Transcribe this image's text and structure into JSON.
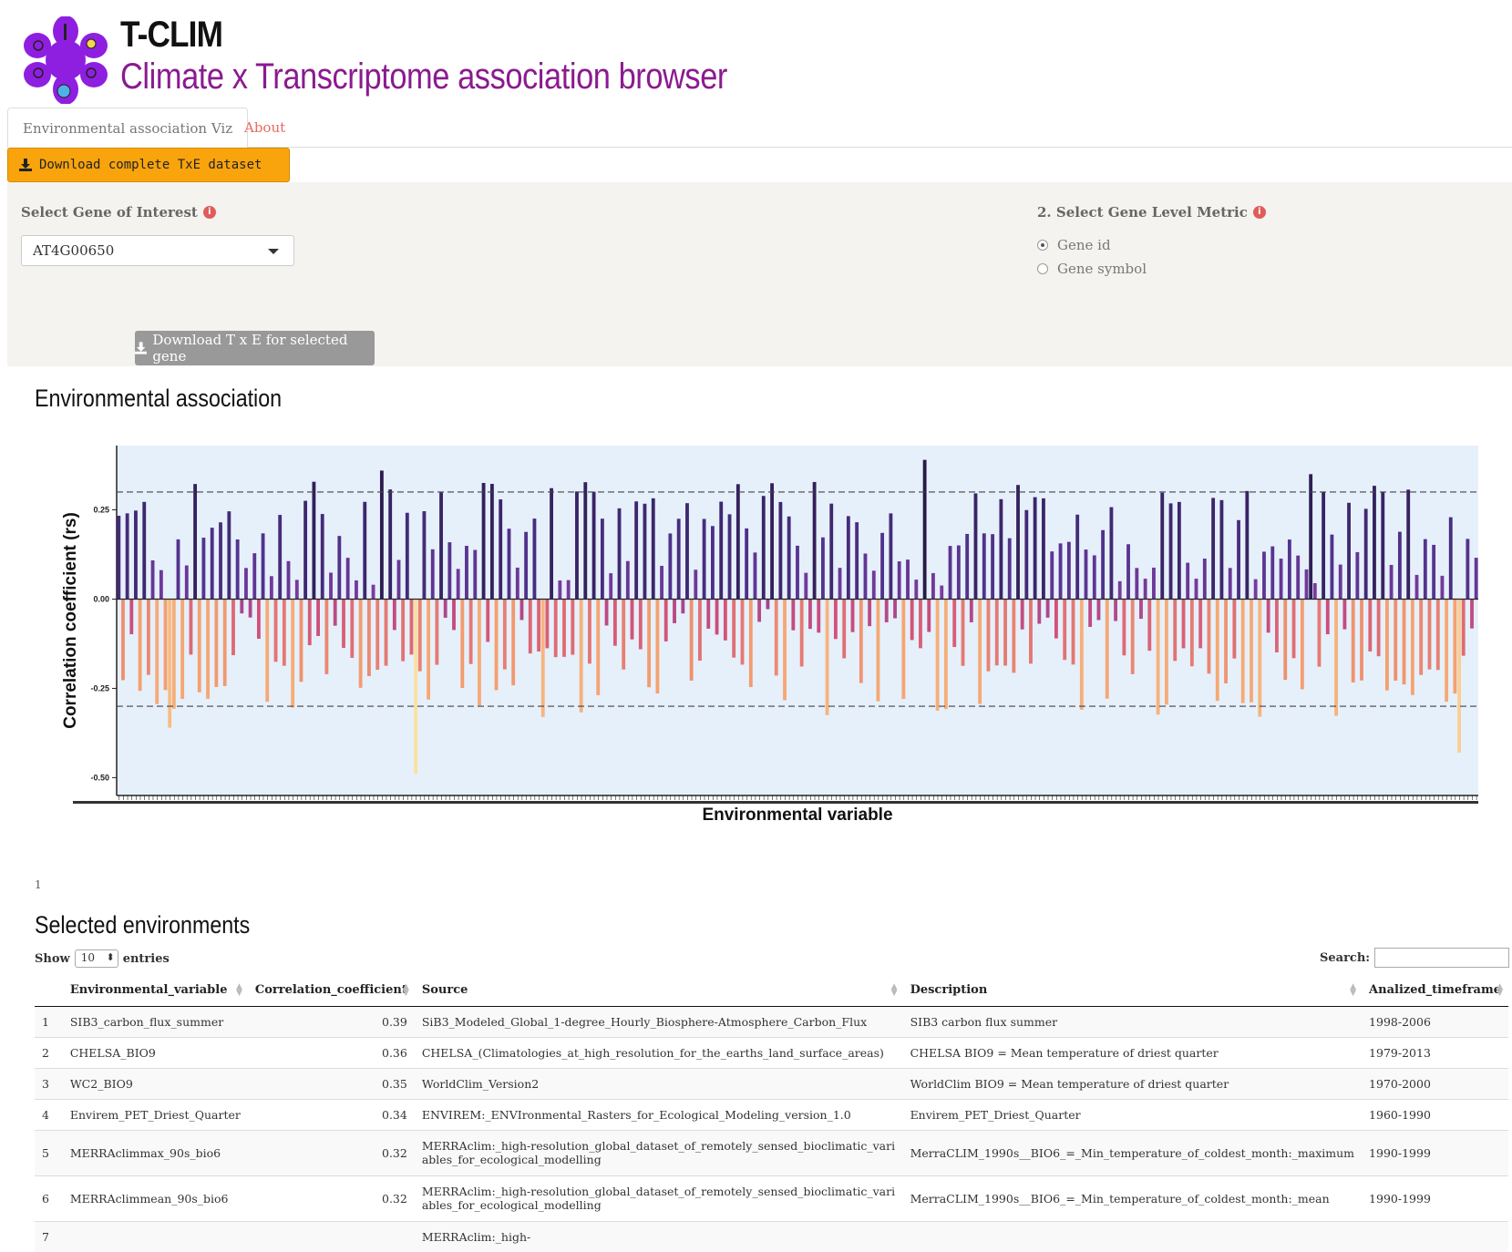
{
  "header": {
    "title": "T-CLIM",
    "subtitle": "Climate x Transcriptome association browser"
  },
  "tabs": [
    {
      "label": "Environmental association Viz",
      "active": true
    },
    {
      "label": "About",
      "active": false
    }
  ],
  "download_all_label": "Download complete TxE dataset",
  "controls": {
    "gene_label": "Select Gene of Interest",
    "gene_value": "AT4G00650",
    "metric_label": "2. Select Gene Level Metric",
    "metric_options": [
      {
        "label": "Gene id",
        "selected": true
      },
      {
        "label": "Gene symbol",
        "selected": false
      }
    ],
    "download_gene_label": "Download T x E for selected gene"
  },
  "sections": {
    "association_title": "Environmental association",
    "selected_title": "Selected environments",
    "stray_text": "1"
  },
  "colors": {
    "accent_orange": "#f9a40c",
    "title_purple": "#8a1b8f",
    "plot_bg": "#e6f0fb",
    "bar_high": "#2d1e4e",
    "bar_low": "#f4e3a0"
  },
  "chart_data": {
    "type": "bar",
    "title": "",
    "xlabel": "Environmental variable",
    "ylabel": "Correlation coefficient (rs)",
    "ylim": [
      -0.55,
      0.43
    ],
    "yticks": [
      "0.25",
      "0.00",
      "-0.25",
      "-0.50"
    ],
    "ytick_values": [
      0.25,
      0,
      -0.25,
      -0.5
    ],
    "threshold_lines": [
      0.3,
      -0.3
    ],
    "n_bars": 321,
    "max_value": 0.39,
    "min_value": -0.49,
    "color_scale": "magma-like: dark navy for high positive, purple, pink, orange, pale yellow for most negative"
  },
  "table": {
    "show_label": "Show",
    "entries_label": "entries",
    "page_length": "10",
    "search_label": "Search:",
    "columns": [
      "",
      "Environmental_variable",
      "Correlation_coefficient",
      "Source",
      "Description",
      "Analized_timeframe"
    ],
    "rows": [
      [
        "1",
        "SIB3_carbon_flux_summer",
        "0.39",
        "SiB3_Modeled_Global_1-degree_Hourly_Biosphere-Atmosphere_Carbon_Flux",
        "SIB3 carbon flux summer",
        "1998-2006"
      ],
      [
        "2",
        "CHELSA_BIO9",
        "0.36",
        "CHELSA_(Climatologies_at_high_resolution_for_the_earths_land_surface_areas)",
        "CHELSA BIO9 = Mean temperature of driest quarter",
        "1979-2013"
      ],
      [
        "3",
        "WC2_BIO9",
        "0.35",
        "WorldClim_Version2",
        "WorldClim BIO9 = Mean temperature of driest quarter",
        "1970-2000"
      ],
      [
        "4",
        "Envirem_PET_Driest_Quarter",
        "0.34",
        "ENVIREM:_ENVIronmental_Rasters_for_Ecological_Modeling_version_1.0",
        "Envirem_PET_Driest_Quarter",
        "1960-1990"
      ],
      [
        "5",
        "MERRAclimmax_90s_bio6",
        "0.32",
        "MERRAclim:_high-resolution_global_dataset_of_remotely_sensed_bioclimatic_variables_for_ecological_modelling",
        "MerraCLIM_1990s__BIO6_=_Min_temperature_of_coldest_month:_maximum",
        "1990-1999"
      ],
      [
        "6",
        "MERRAclimmean_90s_bio6",
        "0.32",
        "MERRAclim:_high-resolution_global_dataset_of_remotely_sensed_bioclimatic_variables_for_ecological_modelling",
        "MerraCLIM_1990s__BIO6_=_Min_temperature_of_coldest_month:_mean",
        "1990-1999"
      ],
      [
        "7",
        "",
        "",
        "MERRAclim:_high-",
        "",
        ""
      ]
    ]
  }
}
